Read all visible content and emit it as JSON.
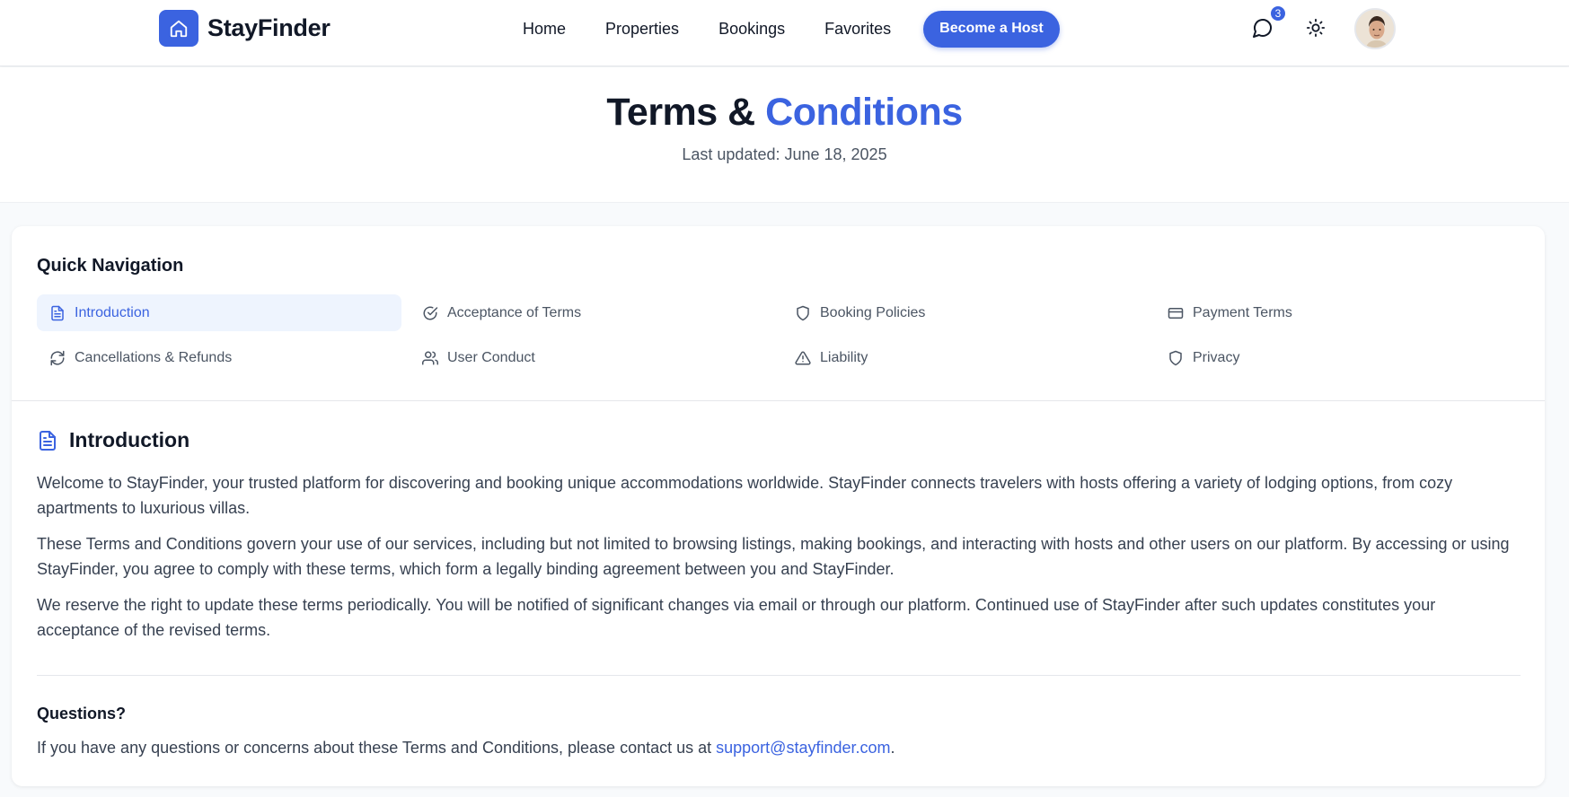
{
  "header": {
    "brand": "StayFinder",
    "nav": [
      "Home",
      "Properties",
      "Bookings",
      "Favorites"
    ],
    "host_button": "Become a Host",
    "message_count": "3"
  },
  "hero": {
    "title_main": "Terms &",
    "title_accent": "Conditions",
    "updated": "Last updated: June 18, 2025"
  },
  "quick_nav": {
    "title": "Quick Navigation",
    "items": [
      {
        "label": "Introduction",
        "icon": "document-icon"
      },
      {
        "label": "Acceptance of Terms",
        "icon": "check-circle-icon"
      },
      {
        "label": "Booking Policies",
        "icon": "shield-icon"
      },
      {
        "label": "Payment Terms",
        "icon": "credit-card-icon"
      },
      {
        "label": "Cancellations & Refunds",
        "icon": "refresh-icon"
      },
      {
        "label": "User Conduct",
        "icon": "users-icon"
      },
      {
        "label": "Liability",
        "icon": "warning-icon"
      },
      {
        "label": "Privacy",
        "icon": "shield-icon"
      }
    ]
  },
  "section": {
    "title": "Introduction",
    "paragraphs": [
      "Welcome to StayFinder, your trusted platform for discovering and booking unique accommodations worldwide. StayFinder connects travelers with hosts offering a variety of lodging options, from cozy apartments to luxurious villas.",
      "These Terms and Conditions govern your use of our services, including but not limited to browsing listings, making bookings, and interacting with hosts and other users on our platform. By accessing or using StayFinder, you agree to comply with these terms, which form a legally binding agreement between you and StayFinder.",
      "We reserve the right to update these terms periodically. You will be notified of significant changes via email or through our platform. Continued use of StayFinder after such updates constitutes your acceptance of the revised terms."
    ]
  },
  "questions": {
    "title": "Questions?",
    "text": "If you have any questions or concerns about these Terms and Conditions, please contact us at",
    "email": "support@stayfinder.com",
    "end": "."
  },
  "colors": {
    "accent": "#3b63e0"
  }
}
